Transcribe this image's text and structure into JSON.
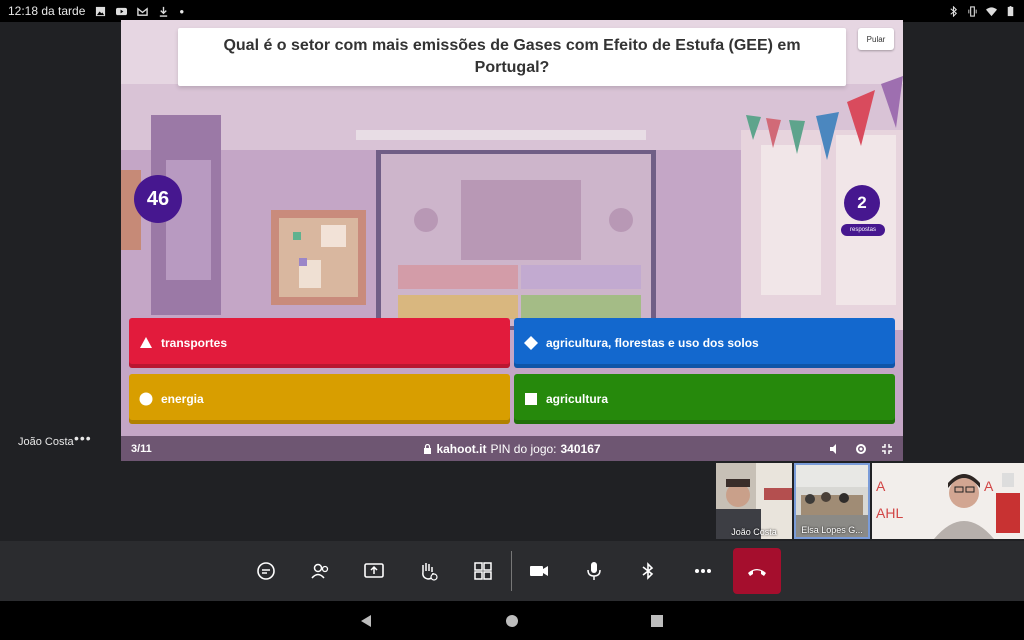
{
  "status_bar": {
    "time": "12:18 da tarde"
  },
  "presenter": {
    "name": "João Costa",
    "more": "•••"
  },
  "kahoot": {
    "question": "Qual é o setor com mais emissões de Gases com Efeito de Estufa (GEE) em Portugal?",
    "skip_label": "Pular",
    "timer": "46",
    "answers_count": "2",
    "answers_label": "respostas",
    "answers": [
      {
        "label": "transportes",
        "shape": "triangle",
        "color": "#e21b3c"
      },
      {
        "label": "agricultura, florestas e uso dos solos",
        "shape": "diamond",
        "color": "#1368ce"
      },
      {
        "label": "energia",
        "shape": "circle",
        "color": "#d89e00"
      },
      {
        "label": "agricultura",
        "shape": "square",
        "color": "#26890c"
      }
    ],
    "footer": {
      "progress": "3/11",
      "site": "kahoot.it",
      "pin_label": "PIN do jogo:",
      "pin": "340167"
    }
  },
  "participants": [
    {
      "name": "João Costa"
    },
    {
      "name": "Elsa Lopes G..."
    },
    {
      "name": ""
    }
  ],
  "toolbar": {
    "buttons": [
      "chat-icon",
      "people-icon",
      "share-screen-icon",
      "raise-hand-icon",
      "apps-icon",
      "camera-icon",
      "microphone-icon",
      "bluetooth-icon",
      "more-icon",
      "hang-up-icon"
    ],
    "hangup_color": "#a50e2d"
  }
}
